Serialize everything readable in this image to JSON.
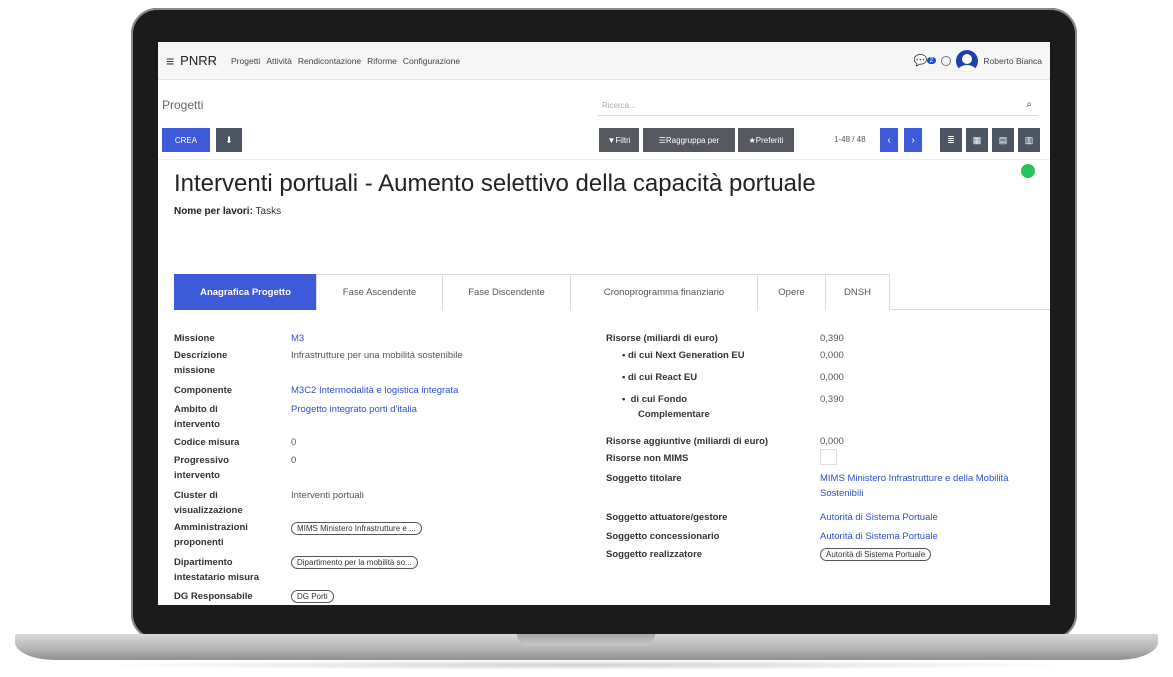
{
  "navbar": {
    "app_name": "PNRR",
    "menu": [
      "Progetti",
      "Attività",
      "Rendicontazione",
      "Riforme",
      "Configurazione"
    ],
    "chat_count": "2",
    "user_name": "Roberto Bianca"
  },
  "control": {
    "breadcrumb": "Progetti",
    "search_placeholder": "Ricerca...",
    "create_label": "CREA",
    "filters_label": "Filtri",
    "groupby_label": "Raggruppa per",
    "favorites_label": "Preferiti",
    "pager": "1-48 / 48"
  },
  "record": {
    "title": "Interventi portuali - Aumento selettivo della capacità portuale",
    "tasks_label": "Nome per lavori:",
    "tasks_value": "Tasks",
    "status_color": "#22c55e"
  },
  "tabs": [
    "Anagrafica Progetto",
    "Fase Ascendente",
    "Fase Discendente",
    "Cronoprogramma finanziario",
    "Opere",
    "DNSH"
  ],
  "left_fields": {
    "missione": {
      "label": "Missione",
      "value": "M3"
    },
    "descrizione": {
      "label": "Descrizione missione",
      "value": "Infrastrutture per una mobilità sostenibile"
    },
    "componente": {
      "label": "Componente",
      "value": "M3C2 Intermodalità e logistica integrata"
    },
    "ambito": {
      "label": "Ambito di intervento",
      "value": "Progetto integrato porti d'italia"
    },
    "codice": {
      "label": "Codice misura",
      "value": "0"
    },
    "progressivo": {
      "label": "Progressivo intervento",
      "value": "0"
    },
    "cluster": {
      "label": "Cluster di visualizzazione",
      "value": "Interventi portuali"
    },
    "amministrazioni": {
      "label": "Amministrazioni proponenti",
      "value": "MIMS Ministero Infrastrutture e ..."
    },
    "dipartimento": {
      "label": "Dipartimento intestatario misura",
      "value": "Dipartimento per la mobilità so..."
    },
    "dg": {
      "label": "DG Responsabile",
      "value": "DG Porti"
    }
  },
  "right_fields": {
    "risorse": {
      "label": "Risorse (miliardi di euro)",
      "value": "0,390"
    },
    "next_gen": {
      "label": "di cui Next Generation EU",
      "value": "0,000"
    },
    "react": {
      "label": "di cui React EU",
      "value": "0,000"
    },
    "fondo": {
      "label": "di cui Fondo Complementare",
      "value": "0,390"
    },
    "aggiuntive": {
      "label": "Risorse aggiuntive (miliardi di euro)",
      "value": "0,000"
    },
    "non_mims": {
      "label": "Risorse non MIMS"
    },
    "titolare": {
      "label": "Soggetto titolare",
      "value": "MIMS Ministero Infrastrutture e della Mobilità Sostenibili"
    },
    "attuatore": {
      "label": "Soggetto attuatore/gestore",
      "value": "Autorità di Sistema Portuale"
    },
    "concessionario": {
      "label": "Soggetto concessionario",
      "value": "Autorità di Sistema Portuale"
    },
    "realizzatore": {
      "label": "Soggetto realizzatore",
      "value": "Autorità di Sistema Portuale"
    }
  }
}
